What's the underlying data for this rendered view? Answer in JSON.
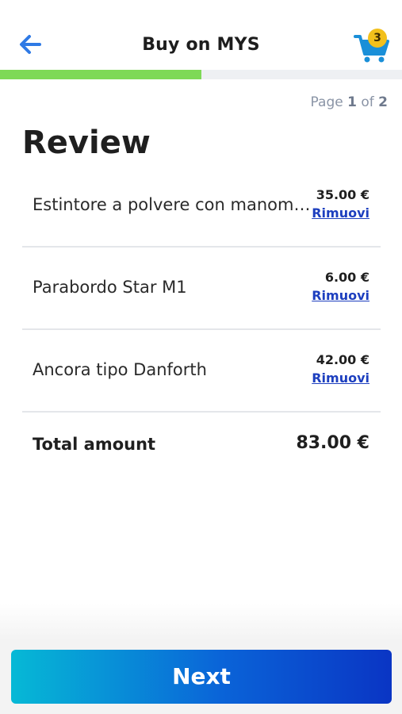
{
  "header": {
    "title": "Buy on MYS",
    "cart_count": "3",
    "back_icon": "arrow-left-icon",
    "cart_icon": "shopping-cart-icon"
  },
  "progress": {
    "current_page": 1,
    "total_pages": 2,
    "fill_fraction": 0.5,
    "color": "#7ed957"
  },
  "page_indicator": {
    "prefix": "Page",
    "current": "1",
    "sep": "of",
    "total": "2"
  },
  "heading": "Review",
  "items": [
    {
      "name": "Estintore a polvere con manometro",
      "price": "35.00 €",
      "remove_label": "Rimuovi"
    },
    {
      "name": "Parabordo Star M1",
      "price": "6.00 €",
      "remove_label": "Rimuovi"
    },
    {
      "name": "Ancora tipo Danforth",
      "price": "42.00 €",
      "remove_label": "Rimuovi"
    }
  ],
  "total": {
    "label": "Total amount",
    "value": "83.00 €"
  },
  "next_button": {
    "label": "Next"
  },
  "colors": {
    "accent_blue": "#1d6fe0",
    "link_blue": "#1d3fbf",
    "badge_yellow": "#f2c01c",
    "button_gradient_start": "#06b9d6",
    "button_gradient_end": "#0a35c4"
  }
}
